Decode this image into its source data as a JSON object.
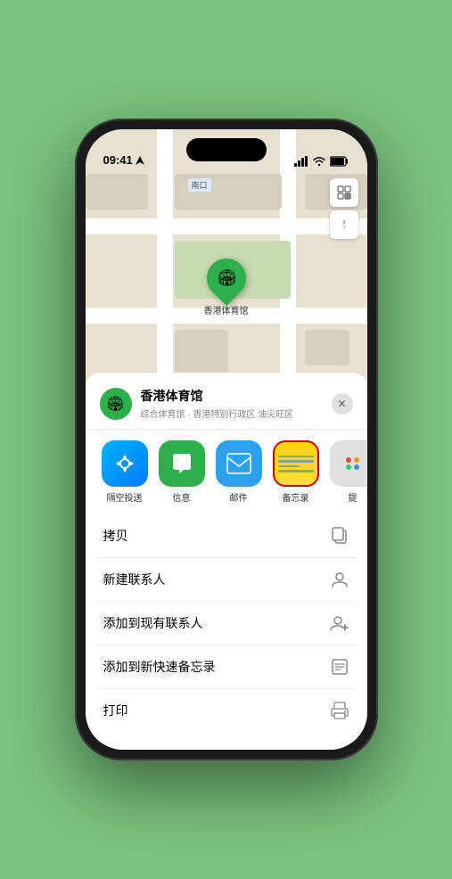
{
  "status_bar": {
    "time": "09:41",
    "location_icon": "▶",
    "signal": "▐▐▐▐",
    "wifi": "WiFi",
    "battery": "🔋"
  },
  "map": {
    "label": "南口",
    "venue_label": "香港体育馆"
  },
  "map_controls": {
    "map_icon": "🗺",
    "compass_icon": "⊕"
  },
  "sheet": {
    "venue_name": "香港体育馆",
    "venue_desc": "综合体育馆 · 香港特别行政区 油尖旺区",
    "close_label": "✕"
  },
  "apps": [
    {
      "id": "airdrop",
      "label": "隔空投送",
      "icon_type": "airdrop"
    },
    {
      "id": "messages",
      "label": "信息",
      "icon_type": "messages"
    },
    {
      "id": "mail",
      "label": "邮件",
      "icon_type": "mail"
    },
    {
      "id": "notes",
      "label": "备忘录",
      "icon_type": "notes"
    },
    {
      "id": "more",
      "label": "提",
      "icon_type": "more"
    }
  ],
  "actions": [
    {
      "id": "copy",
      "label": "拷贝",
      "icon": "copy"
    },
    {
      "id": "new-contact",
      "label": "新建联系人",
      "icon": "person"
    },
    {
      "id": "add-contact",
      "label": "添加到现有联系人",
      "icon": "person-add"
    },
    {
      "id": "quick-note",
      "label": "添加到新快速备忘录",
      "icon": "note"
    },
    {
      "id": "print",
      "label": "打印",
      "icon": "printer"
    }
  ],
  "colors": {
    "green": "#2db04b",
    "red": "#cc0000",
    "map_bg": "#e8e0d0"
  }
}
